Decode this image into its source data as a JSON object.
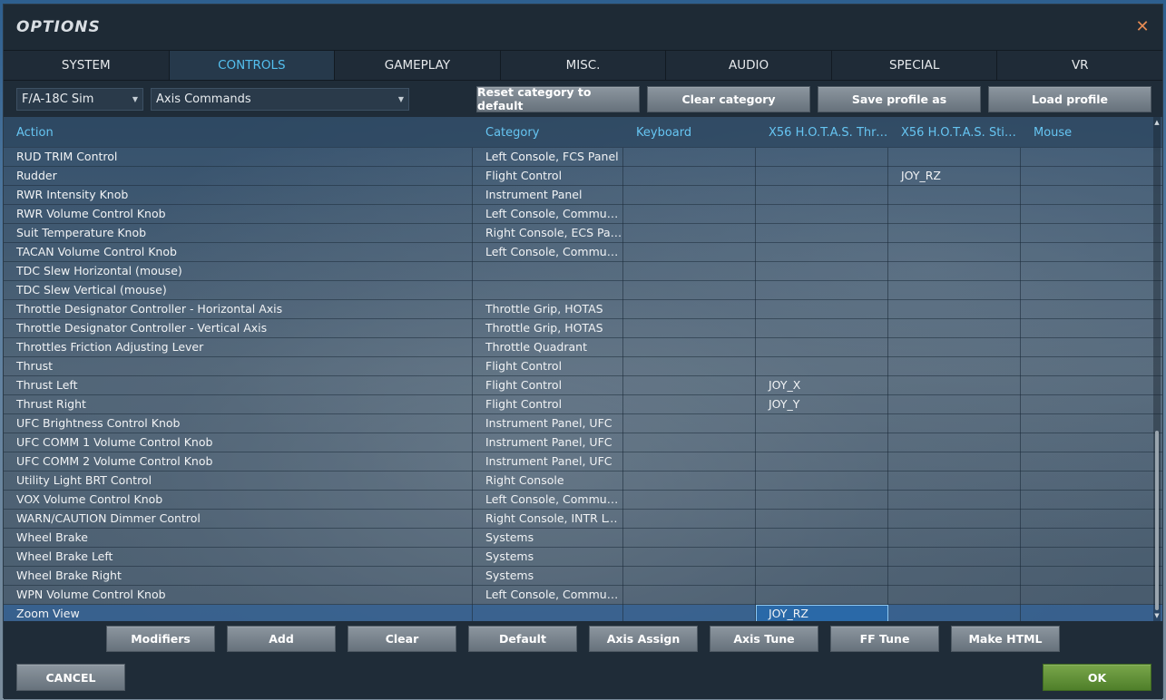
{
  "window": {
    "title": "OPTIONS"
  },
  "tabs": [
    {
      "label": "SYSTEM"
    },
    {
      "label": "CONTROLS"
    },
    {
      "label": "GAMEPLAY"
    },
    {
      "label": "MISC."
    },
    {
      "label": "AUDIO"
    },
    {
      "label": "SPECIAL"
    },
    {
      "label": "VR"
    }
  ],
  "toolbar": {
    "aircraft_select": "F/A-18C Sim",
    "category_select": "Axis Commands",
    "reset_label": "Reset category to default",
    "clear_category_label": "Clear category",
    "save_profile_label": "Save profile as",
    "load_profile_label": "Load profile"
  },
  "grid": {
    "headers": [
      "Action",
      "Category",
      "Keyboard",
      "X56 H.O.T.A.S. Thro...",
      "X56 H.O.T.A.S. Stick...",
      "Mouse"
    ],
    "rows": [
      [
        "RUD TRIM Control",
        "Left Console, FCS Panel",
        "",
        "",
        "",
        ""
      ],
      [
        "Rudder",
        "Flight Control",
        "",
        "",
        "JOY_RZ",
        ""
      ],
      [
        "RWR Intensity Knob",
        "Instrument Panel",
        "",
        "",
        "",
        ""
      ],
      [
        "RWR Volume Control Knob",
        "Left Console, Communicat",
        "",
        "",
        "",
        ""
      ],
      [
        "Suit Temperature Knob",
        "Right Console, ECS Panel",
        "",
        "",
        "",
        ""
      ],
      [
        "TACAN Volume Control Knob",
        "Left Console, Communicat",
        "",
        "",
        "",
        ""
      ],
      [
        "TDC Slew Horizontal (mouse)",
        "",
        "",
        "",
        "",
        ""
      ],
      [
        "TDC Slew Vertical (mouse)",
        "",
        "",
        "",
        "",
        ""
      ],
      [
        "Throttle Designator Controller - Horizontal Axis",
        "Throttle Grip, HOTAS",
        "",
        "",
        "",
        ""
      ],
      [
        "Throttle Designator Controller - Vertical Axis",
        "Throttle Grip, HOTAS",
        "",
        "",
        "",
        ""
      ],
      [
        "Throttles Friction Adjusting Lever",
        "Throttle Quadrant",
        "",
        "",
        "",
        ""
      ],
      [
        "Thrust",
        "Flight Control",
        "",
        "",
        "",
        ""
      ],
      [
        "Thrust Left",
        "Flight Control",
        "",
        "JOY_X",
        "",
        ""
      ],
      [
        "Thrust Right",
        "Flight Control",
        "",
        "JOY_Y",
        "",
        ""
      ],
      [
        "UFC Brightness Control Knob",
        "Instrument Panel, UFC",
        "",
        "",
        "",
        ""
      ],
      [
        "UFC COMM 1 Volume Control Knob",
        "Instrument Panel, UFC",
        "",
        "",
        "",
        ""
      ],
      [
        "UFC COMM 2 Volume Control Knob",
        "Instrument Panel, UFC",
        "",
        "",
        "",
        ""
      ],
      [
        "Utility Light BRT Control",
        "Right Console",
        "",
        "",
        "",
        ""
      ],
      [
        "VOX Volume Control Knob",
        "Left Console, Communicat",
        "",
        "",
        "",
        ""
      ],
      [
        "WARN/CAUTION Dimmer Control",
        "Right Console, INTR LT Co",
        "",
        "",
        "",
        ""
      ],
      [
        "Wheel Brake",
        "Systems",
        "",
        "",
        "",
        ""
      ],
      [
        "Wheel Brake Left",
        "Systems",
        "",
        "",
        "",
        ""
      ],
      [
        "Wheel Brake Right",
        "Systems",
        "",
        "",
        "",
        ""
      ],
      [
        "WPN Volume Control Knob",
        "Left Console, Communicat",
        "",
        "",
        "",
        ""
      ],
      [
        "Zoom View",
        "",
        "",
        "JOY_RZ",
        "",
        ""
      ]
    ]
  },
  "actions": [
    "Modifiers",
    "Add",
    "Clear",
    "Default",
    "Axis Assign",
    "Axis Tune",
    "FF Tune",
    "Make HTML"
  ],
  "footer": {
    "cancel_label": "CANCEL",
    "ok_label": "OK"
  },
  "colors": {
    "accent": "#54c0ef",
    "ok": "#5b8a33",
    "close": "#e58b54"
  }
}
